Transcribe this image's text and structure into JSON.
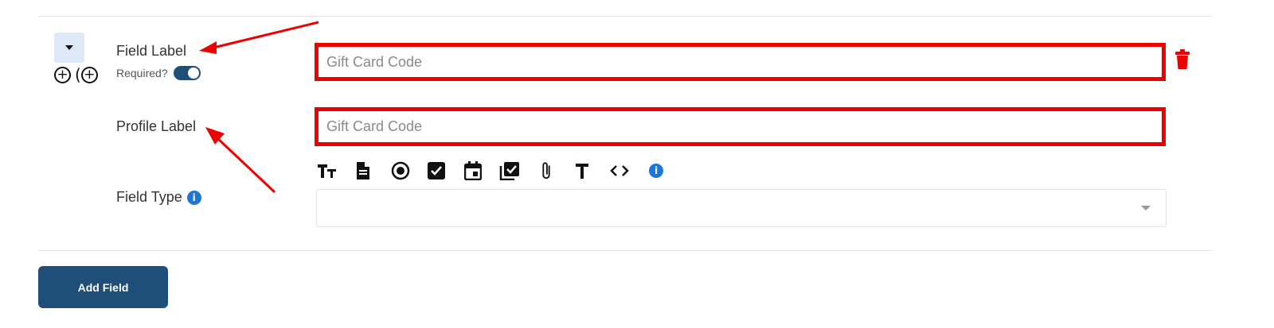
{
  "field_row": {
    "field_label": "Field Label",
    "required_label": "Required?",
    "required_on": true,
    "field_input_placeholder": "Gift Card Code",
    "profile_label": "Profile Label",
    "profile_input_placeholder": "Gift Card Code",
    "field_type_label": "Field Type",
    "field_type_selected": "",
    "field_type_icons": [
      "text-size-icon",
      "document-icon",
      "radio-icon",
      "checkbox-icon",
      "calendar-icon",
      "multi-checkbox-icon",
      "attachment-icon",
      "text-icon",
      "code-icon",
      "info-icon"
    ]
  },
  "colors": {
    "accent": "#1f4e78",
    "highlight_red": "#ee0000",
    "info_blue": "#1e76d8",
    "collapse_bg": "#dde9f7"
  },
  "footer": {
    "add_field_label": "Add Field"
  }
}
